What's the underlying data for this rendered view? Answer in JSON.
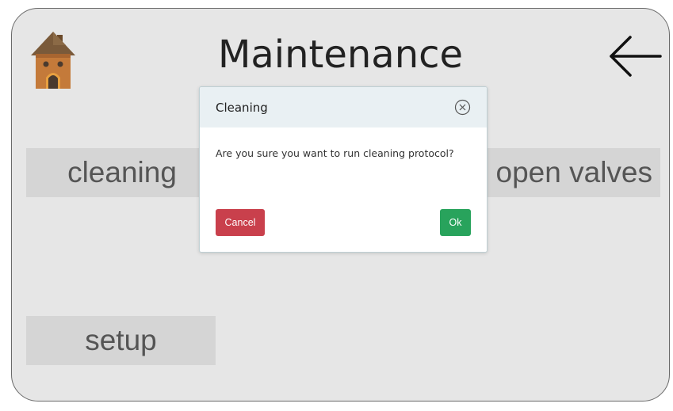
{
  "header": {
    "title": "Maintenance",
    "home_icon": "home-icon",
    "back_icon": "back-arrow-icon"
  },
  "menu": {
    "cleaning_label": "cleaning",
    "open_valves_label": "open valves",
    "setup_label": "setup"
  },
  "dialog": {
    "title": "Cleaning",
    "message": "Are you sure you want to run cleaning protocol?",
    "cancel_label": "Cancel",
    "ok_label": "Ok",
    "close_icon": "close-icon"
  },
  "colors": {
    "cancel": "#c9404c",
    "ok": "#28a35c",
    "screen_bg": "#e6e6e6",
    "dialog_header": "#e9f0f3"
  }
}
